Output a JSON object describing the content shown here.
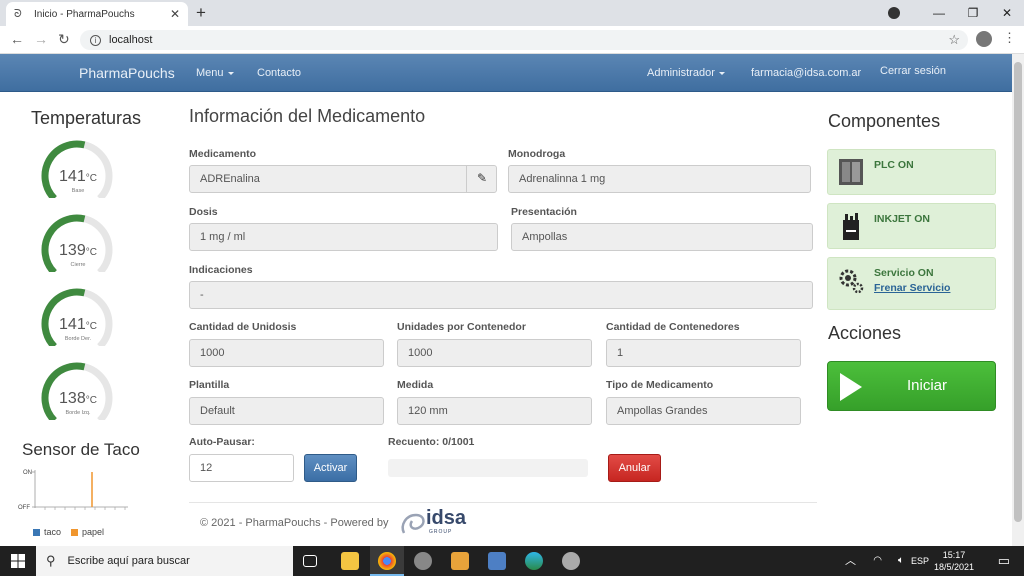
{
  "browser": {
    "tab_title": "Inicio - PharmaPouchs",
    "url": "localhost"
  },
  "navbar": {
    "brand": "PharmaPouchs",
    "menu": "Menu",
    "contacto": "Contacto",
    "user": "Administrador",
    "email": "farmacia@idsa.com.ar",
    "logout": "Cerrar sesión"
  },
  "temperaturas": {
    "title": "Temperaturas",
    "unit": "°C",
    "gauges": [
      {
        "value": "141",
        "label": "Base",
        "fraction": 0.55
      },
      {
        "value": "139",
        "label": "Cierre",
        "fraction": 0.55
      },
      {
        "value": "141",
        "label": "Borde Der.",
        "fraction": 0.55
      },
      {
        "value": "138",
        "label": "Borde Izq.",
        "fraction": 0.55
      }
    ]
  },
  "sensor": {
    "title": "Sensor de Taco",
    "on_label": "ON",
    "off_label": "OFF",
    "legend": [
      {
        "name": "taco",
        "color": "#3a77b5"
      },
      {
        "name": "papel",
        "color": "#f0962e"
      }
    ]
  },
  "form": {
    "title": "Información del Medicamento",
    "medicamento_label": "Medicamento",
    "medicamento_value": "ADREnalina",
    "monodroga_label": "Monodroga",
    "monodroga_value": "Adrenalinna 1 mg",
    "dosis_label": "Dosis",
    "dosis_value": "1 mg / ml",
    "presentacion_label": "Presentación",
    "presentacion_value": "Ampollas",
    "indicaciones_label": "Indicaciones",
    "indicaciones_value": "-",
    "cant_unidosis_label": "Cantidad de Unidosis",
    "cant_unidosis_value": "1000",
    "unidades_cont_label": "Unidades por Contenedor",
    "unidades_cont_value": "1000",
    "cant_cont_label": "Cantidad de Contenedores",
    "cant_cont_value": "1",
    "plantilla_label": "Plantilla",
    "plantilla_value": "Default",
    "medida_label": "Medida",
    "medida_value": "120 mm",
    "tipo_label": "Tipo de Medicamento",
    "tipo_value": "Ampollas Grandes",
    "autopausar_label": "Auto-Pausar:",
    "autopausar_value": "12",
    "activar": "Activar",
    "recuento_label": "Recuento: 0/1001",
    "recuento_fraction": 0,
    "anular": "Anular"
  },
  "footer": {
    "text": "© 2021 - PharmaPouchs - Powered by",
    "logo_word": "idsa",
    "logo_sub": "GROUP"
  },
  "componentes": {
    "title": "Componentes",
    "plc": "PLC ON",
    "inkjet": "INKJET ON",
    "servicio": "Servicio ON",
    "frenar": "Frenar Servicio"
  },
  "acciones": {
    "title": "Acciones",
    "iniciar": "Iniciar"
  },
  "taskbar": {
    "search_placeholder": "Escribe aquí para buscar",
    "lang": "ESP",
    "time": "15:17",
    "date": "18/5/2021"
  },
  "colors": {
    "gauge_fill": "#3f8a3f",
    "gauge_track": "#e6e6e6",
    "component_bg": "#dff0d8",
    "component_text": "#3c763d"
  }
}
